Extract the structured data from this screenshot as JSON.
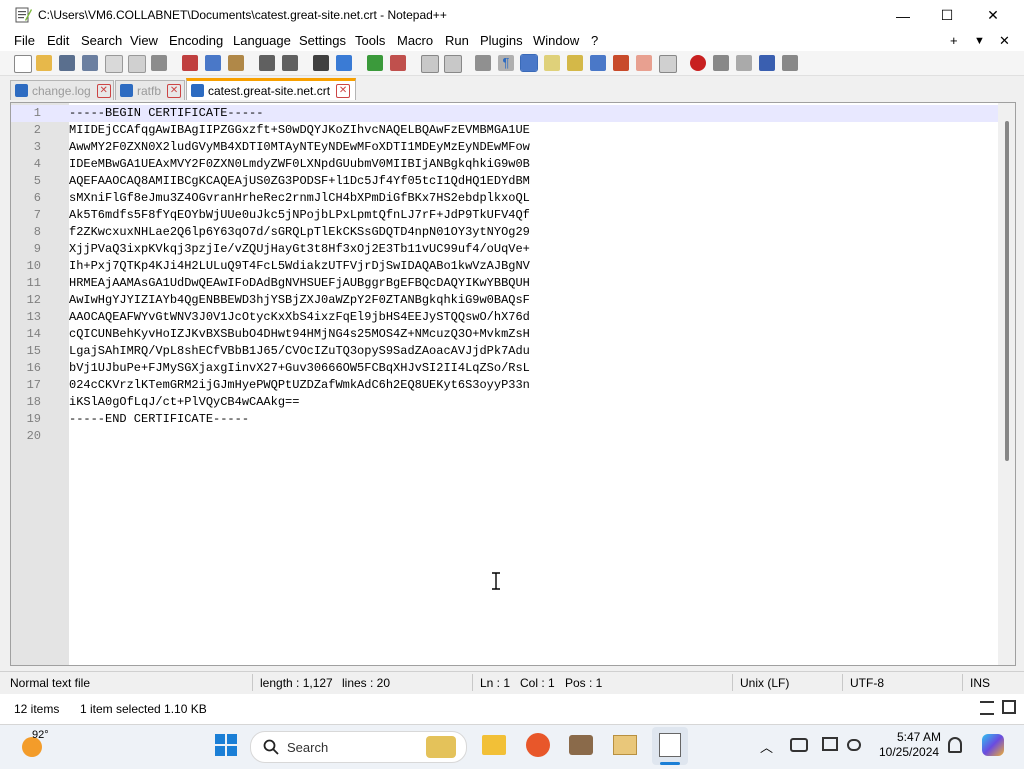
{
  "window": {
    "title": "C:\\Users\\VM6.COLLABNET\\Documents\\catest.great-site.net.crt - Notepad++",
    "minimize": "—",
    "maximize": "☐",
    "close": "✕"
  },
  "menu": {
    "items": [
      "File",
      "Edit",
      "Search",
      "View",
      "Encoding",
      "Language",
      "Settings",
      "Tools",
      "Macro",
      "Run",
      "Plugins",
      "Window",
      "?"
    ],
    "right": [
      "+",
      "▼",
      "✕"
    ]
  },
  "tabs": [
    {
      "label": "change.log",
      "active": false
    },
    {
      "label": "ratfb",
      "active": false
    },
    {
      "label": "catest.great-site.net.crt",
      "active": true
    }
  ],
  "editor": {
    "lines": [
      "-----BEGIN CERTIFICATE-----",
      "MIIDEjCCAfqgAwIBAgIIPZGGxzft+S0wDQYJKoZIhvcNAQELBQAwFzEVMBMGA1UE",
      "AwwMY2F0ZXN0X2ludGVyMB4XDTI0MTAyNTEyNDEwMFoXDTI1MDEyMzEyNDEwMFow",
      "IDEeMBwGA1UEAxMVY2F0ZXN0LmdyZWF0LXNpdGUubmV0MIIBIjANBgkqhkiG9w0B",
      "AQEFAAOCAQ8AMIIBCgKCAQEAjUS0ZG3PODSF+l1Dc5Jf4Yf05tcI1QdHQ1EDYdBM",
      "sMXniFlGf8eJmu3Z4OGvranHrheRec2rnmJlCH4bXPmDiGfBKx7HS2ebdplkxoQL",
      "Ak5T6mdfs5F8fYqEOYbWjUUe0uJkc5jNPojbLPxLpmtQfnLJ7rF+JdP9TkUFV4Qf",
      "f2ZKwcxuxNHLae2Q6lp6Y63qO7d/sGRQLpTlEkCKSsGDQTD4npN01OY3ytNYOg29",
      "XjjPVaQ3ixpKVkqj3pzjIe/vZQUjHayGt3t8Hf3xOj2E3Tb11vUC99uf4/oUqVe+",
      "Ih+Pxj7QTKp4KJi4H2LULuQ9T4FcL5WdiakzUTFVjrDjSwIDAQABo1kwVzAJBgNV",
      "HRMEAjAAMAsGA1UdDwQEAwIFoDAdBgNVHSUEFjAUBggrBgEFBQcDAQYIKwYBBQUH",
      "AwIwHgYJYIZIAYb4QgENBBEWD3hjYSBjZXJ0aWZpY2F0ZTANBgkqhkiG9w0BAQsF",
      "AAOCAQEAFWYvGtWNV3J0V1JcOtycKxXbS4ixzFqEl9jbHS4EEJySTQQswO/hX76d",
      "cQICUNBehKyvHoIZJKvBXSBubO4DHwt94HMjNG4s25MOS4Z+NMcuzQ3O+MvkmZsH",
      "LgajSAhIMRQ/VpL8shECfVBbB1J65/CVOcIZuTQ3opyS9SadZAoacAVJjdPk7Adu",
      "bVj1UJbuPe+FJMySGXjaxgIinvX27+Guv30666OW5FCBqXHJvSI2II4LqZSo/RsL",
      "024cCKVrzlKTemGRM2ijGJmHyePWQPtUZDZafWmkAdC6h2EQ8UEKyt6S3oyyP33n",
      "iKSlA0gOfLqJ/ct+PlVQyCB4wCAAkg==",
      "-----END CERTIFICATE-----",
      ""
    ]
  },
  "status": {
    "file_type": "Normal text file",
    "length": "length : 1,127",
    "lines": "lines : 20",
    "ln": "Ln : 1",
    "col": "Col : 1",
    "pos": "Pos : 1",
    "eol": "Unix (LF)",
    "encoding": "UTF-8",
    "mode": "INS"
  },
  "explorer": {
    "items": "12 items",
    "selected": "1 item selected  1.10 KB"
  },
  "taskbar": {
    "weather": "92°",
    "search_placeholder": "Search",
    "time": "5:47 AM",
    "date": "10/25/2024"
  },
  "colors": {
    "active_tab_accent": "#f8a000",
    "current_line": "#e8e8ff",
    "gutter": "#e4e4e4",
    "tab_disk": "#2d6bc1"
  }
}
